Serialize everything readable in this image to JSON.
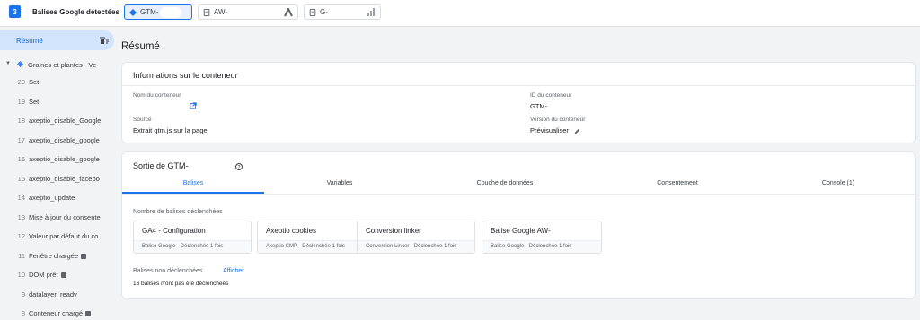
{
  "header": {
    "count": "3",
    "title": "Balises Google détectées",
    "chips": [
      {
        "label": "GTM-",
        "icon": "gtm-diamond-icon",
        "active": true
      },
      {
        "label": "AW-",
        "icon": "google-ads-icon",
        "active": false
      },
      {
        "label": "G-",
        "icon": "analytics-icon",
        "active": false
      }
    ]
  },
  "sidebar": {
    "summary_label": "Résumé",
    "container_label": "Graines et plantes - Ve",
    "items": [
      {
        "num": "20",
        "label": "Set"
      },
      {
        "num": "19",
        "label": "Set"
      },
      {
        "num": "18",
        "label": "axeptio_disable_Google"
      },
      {
        "num": "17",
        "label": "axeptio_disable_google"
      },
      {
        "num": "16",
        "label": "axeptio_disable_google"
      },
      {
        "num": "15",
        "label": "axeptio_disable_facebo"
      },
      {
        "num": "14",
        "label": "axeptio_update"
      },
      {
        "num": "13",
        "label": "Mise à jour du consente"
      },
      {
        "num": "12",
        "label": "Valeur par défaut du co"
      },
      {
        "num": "11",
        "label": "Fenêtre chargée"
      },
      {
        "num": "10",
        "label": "DOM prêt"
      },
      {
        "num": "9",
        "label": "datalayer_ready"
      },
      {
        "num": "8",
        "label": "Conteneur chargé"
      }
    ]
  },
  "main": {
    "title": "Résumé",
    "info": {
      "title": "Informations sur le conteneur",
      "name_label": "Nom du conteneur",
      "id_label": "ID du conteneur",
      "id_value": "GTM-",
      "source_label": "Source",
      "source_value": "Extrait gtm.js sur la page",
      "version_label": "Version du conteneur",
      "version_value": "Prévisualiser"
    },
    "output": {
      "title": "Sortie de GTM-",
      "tabs": [
        "Balises",
        "Variables",
        "Couche de données",
        "Consentement",
        "Console (1)"
      ],
      "fired_label": "Nombre de balises déclenchées",
      "tags": [
        {
          "name": "GA4 - Configuration",
          "sub": "Balise Google - Déclenchée 1 fois"
        },
        {
          "name": "Axeptio cookies",
          "sub": "Axeptio CMP - Déclenchée 1 fois"
        },
        {
          "name": "Conversion linker",
          "sub": "Conversion Linker - Déclenchée 1 fois"
        },
        {
          "name": "Balise Google AW-",
          "sub": "Balise Google - Déclenchée 1 fois"
        }
      ],
      "not_fired_label": "Balises non déclenchées",
      "show_label": "Afficher",
      "not_fired_count": "16 balises n'ont pas été déclenchées"
    }
  },
  "colors": {
    "accent": "#1a73e8",
    "selected_bg": "#d2e3fc"
  }
}
